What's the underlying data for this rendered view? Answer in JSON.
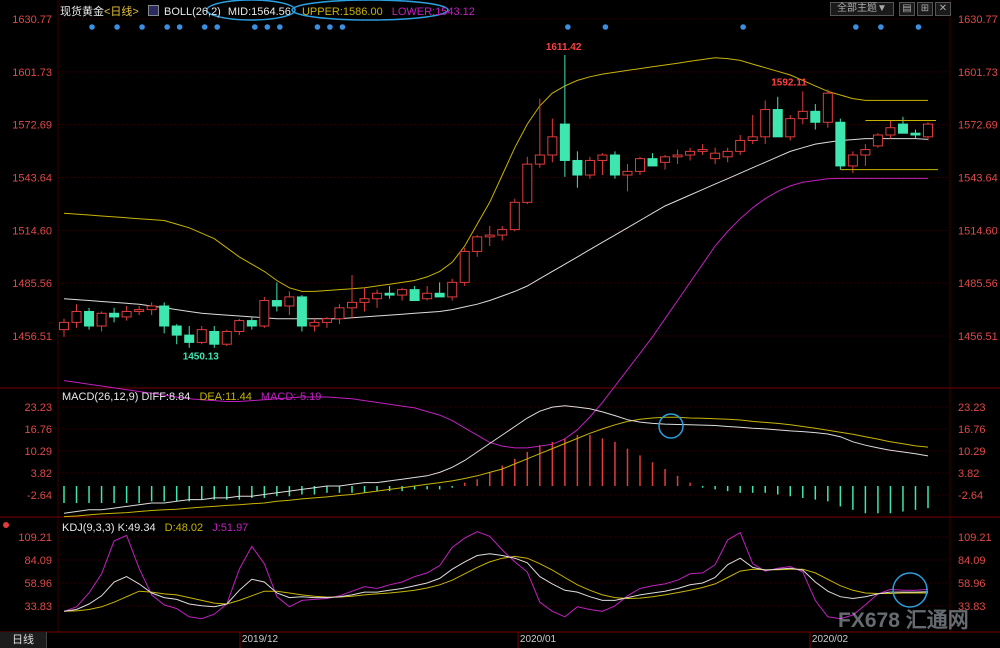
{
  "header": {
    "symbol": "现货黄金",
    "period": "<日线>",
    "indicator": "BOLL(26,2)",
    "mid": "MID:1564.56",
    "upper": "UPPER:1586.00",
    "lower": "LOWER:1543.12",
    "theme_button": "全部主题▼",
    "period_tab": "日线"
  },
  "macd_header": {
    "name": "MACD(26,12,9)",
    "diff": "DIFF:8.84",
    "dea": "DEA:11.44",
    "macd": "MACD:-5.19"
  },
  "kdj_header": {
    "name": "KDJ(9,3,3)",
    "k": "K:49.34",
    "d": "D:48.02",
    "j": "J:51.97"
  },
  "watermark": "FX678 汇通网",
  "colors": {
    "up": "#e03c3c",
    "down": "#3ee6b0",
    "mid": "#dddddd",
    "upper": "#c8b400",
    "lower": "#c020c0",
    "diff": "#dddddd",
    "dea": "#c8b400",
    "j": "#c020c0",
    "signal_dot": "#3a8fe0",
    "highlight": "#2aa0e0"
  },
  "chart_data": [
    {
      "type": "candlestick",
      "title": "现货黄金 日线 BOLL(26,2)",
      "y_ticks": [
        "1630.77",
        "1601.73",
        "1572.69",
        "1543.64",
        "1514.60",
        "1485.56",
        "1456.51"
      ],
      "ylim": [
        1441,
        1636
      ],
      "x_ticks": [
        "2019/12",
        "2020/01",
        "2020/02"
      ],
      "peak_labels": [
        {
          "text": "1611.42",
          "index": 38,
          "value": 1611.42
        },
        {
          "text": "1592.11",
          "index": 56,
          "value": 1592.11
        },
        {
          "text": "1450.13",
          "index": 9,
          "value": 1450.13
        }
      ],
      "ohlc": [
        [
          1460,
          1466,
          1456,
          1464
        ],
        [
          1464,
          1474,
          1461,
          1470
        ],
        [
          1470,
          1472,
          1460,
          1462
        ],
        [
          1462,
          1470,
          1459,
          1469
        ],
        [
          1469,
          1472,
          1464,
          1467
        ],
        [
          1467,
          1473,
          1465,
          1470
        ],
        [
          1470,
          1473,
          1468,
          1471
        ],
        [
          1471,
          1475,
          1468,
          1473
        ],
        [
          1473,
          1475,
          1458,
          1462
        ],
        [
          1462,
          1463,
          1452,
          1457
        ],
        [
          1457,
          1462,
          1450,
          1453
        ],
        [
          1453,
          1462,
          1452,
          1460
        ],
        [
          1459,
          1462,
          1450,
          1452
        ],
        [
          1452,
          1460,
          1451,
          1459
        ],
        [
          1459,
          1466,
          1457,
          1465
        ],
        [
          1465,
          1467,
          1460,
          1462
        ],
        [
          1462,
          1478,
          1461,
          1476
        ],
        [
          1476,
          1486,
          1470,
          1473
        ],
        [
          1473,
          1481,
          1468,
          1478
        ],
        [
          1478,
          1479,
          1459,
          1462
        ],
        [
          1462,
          1466,
          1459,
          1464
        ],
        [
          1464,
          1467,
          1461,
          1466
        ],
        [
          1466,
          1474,
          1463,
          1472
        ],
        [
          1472,
          1490,
          1466,
          1475
        ],
        [
          1475,
          1483,
          1470,
          1477
        ],
        [
          1477,
          1482,
          1472,
          1480
        ],
        [
          1480,
          1484,
          1477,
          1479
        ],
        [
          1479,
          1483,
          1476,
          1482
        ],
        [
          1482,
          1484,
          1478,
          1476
        ],
        [
          1477,
          1484,
          1476,
          1480
        ],
        [
          1480,
          1486,
          1478,
          1478
        ],
        [
          1478,
          1488,
          1476,
          1486
        ],
        [
          1486,
          1505,
          1484,
          1503
        ],
        [
          1503,
          1512,
          1500,
          1511
        ],
        [
          1511,
          1517,
          1506,
          1512
        ],
        [
          1512,
          1517,
          1509,
          1515
        ],
        [
          1515,
          1532,
          1514,
          1530
        ],
        [
          1530,
          1555,
          1529,
          1551
        ],
        [
          1551,
          1587,
          1549,
          1556
        ],
        [
          1556,
          1576,
          1552,
          1566
        ],
        [
          1573,
          1611,
          1544,
          1553
        ],
        [
          1553,
          1558,
          1538,
          1545
        ],
        [
          1545,
          1555,
          1543,
          1553
        ],
        [
          1553,
          1557,
          1545,
          1556
        ],
        [
          1556,
          1558,
          1543,
          1545
        ],
        [
          1545,
          1551,
          1536,
          1547
        ],
        [
          1547,
          1555,
          1545,
          1554
        ],
        [
          1554,
          1557,
          1550,
          1550
        ],
        [
          1552,
          1556,
          1548,
          1555
        ],
        [
          1555,
          1559,
          1551,
          1556
        ],
        [
          1556,
          1560,
          1553,
          1558
        ],
        [
          1558,
          1562,
          1556,
          1559
        ],
        [
          1554,
          1560,
          1551,
          1557
        ],
        [
          1555,
          1560,
          1552,
          1558
        ],
        [
          1558,
          1567,
          1556,
          1564
        ],
        [
          1564,
          1578,
          1562,
          1566
        ],
        [
          1566,
          1586,
          1562,
          1581
        ],
        [
          1581,
          1588,
          1572,
          1566
        ],
        [
          1566,
          1578,
          1564,
          1576
        ],
        [
          1576,
          1591,
          1573,
          1580
        ],
        [
          1580,
          1584,
          1570,
          1574
        ],
        [
          1574,
          1592,
          1571,
          1590
        ],
        [
          1574,
          1576,
          1548,
          1550
        ],
        [
          1550,
          1558,
          1546,
          1556
        ],
        [
          1556,
          1562,
          1550,
          1559
        ],
        [
          1561,
          1568,
          1560,
          1567
        ],
        [
          1567,
          1575,
          1565,
          1571
        ],
        [
          1573,
          1577,
          1569,
          1568
        ],
        [
          1568,
          1570,
          1565,
          1567
        ],
        [
          1566,
          1574,
          1564,
          1573
        ]
      ],
      "mid": [
        1477,
        1476.5,
        1476,
        1475.5,
        1475,
        1474.5,
        1474,
        1473,
        1472,
        1471,
        1470,
        1469,
        1468.5,
        1468,
        1467.5,
        1467,
        1466.5,
        1466,
        1466,
        1466,
        1466,
        1466,
        1466,
        1466.5,
        1467,
        1467.5,
        1468,
        1468.5,
        1469,
        1469.5,
        1470,
        1471,
        1472.5,
        1474,
        1476,
        1478.5,
        1481,
        1484,
        1488,
        1492,
        1496,
        1500,
        1504,
        1508,
        1512,
        1516,
        1520,
        1524,
        1528,
        1531,
        1534,
        1537,
        1540,
        1543,
        1546,
        1549,
        1552,
        1555,
        1558,
        1560,
        1562,
        1563,
        1564,
        1564.5,
        1565,
        1565,
        1565,
        1565,
        1565,
        1564.56
      ],
      "upper": [
        1524,
        1523.5,
        1523,
        1522.5,
        1522,
        1521.5,
        1521,
        1520.5,
        1520,
        1518,
        1516,
        1513,
        1510,
        1505,
        1500,
        1496,
        1492,
        1487,
        1483,
        1481,
        1481,
        1481.5,
        1482,
        1482.5,
        1483,
        1484,
        1485,
        1486,
        1487,
        1489,
        1492,
        1497,
        1506,
        1518,
        1530,
        1545,
        1560,
        1573,
        1583,
        1590,
        1594,
        1597,
        1599,
        1600.5,
        1601.5,
        1602.5,
        1603.5,
        1604.5,
        1605.5,
        1606.5,
        1607.5,
        1608.5,
        1609.5,
        1609,
        1608,
        1606,
        1604,
        1602,
        1600,
        1597,
        1594,
        1591,
        1589,
        1587,
        1586,
        1586,
        1586,
        1586,
        1586,
        1586
      ],
      "lower": [
        1432,
        1431,
        1430,
        1429,
        1428,
        1427,
        1426,
        1425,
        1424,
        1423,
        1422,
        1421.5,
        1421,
        1420.5,
        1420.5,
        1421,
        1421.5,
        1422,
        1422.5,
        1423,
        1423,
        1423,
        1422.5,
        1422,
        1421,
        1420,
        1419,
        1418,
        1417,
        1415,
        1413,
        1410,
        1406,
        1402,
        1398,
        1396,
        1395,
        1395,
        1396,
        1397,
        1400,
        1405,
        1412,
        1420,
        1429,
        1438,
        1447,
        1456,
        1466,
        1476,
        1486,
        1496,
        1506,
        1514,
        1521,
        1527,
        1532,
        1536,
        1539,
        1541,
        1542,
        1543,
        1543.12
      ]
    },
    {
      "type": "bar",
      "title": "MACD(26,12,9)",
      "y_ticks": [
        "23.23",
        "16.76",
        "10.29",
        "3.82",
        "-2.64"
      ],
      "ylim": [
        -10,
        26
      ],
      "histogram": [
        -5,
        -5,
        -5,
        -5,
        -5,
        -5,
        -5,
        -4.5,
        -4.5,
        -4.5,
        -4.5,
        -4,
        -4,
        -4,
        -4,
        -3.5,
        -3.5,
        -3,
        -3,
        -2.5,
        -2.5,
        -2,
        -2,
        -2,
        -2,
        -1.5,
        -1.5,
        -1.5,
        -1,
        -1,
        -1,
        -0.5,
        1,
        2,
        4,
        6,
        8,
        10,
        12,
        13,
        14,
        15,
        15,
        14,
        13,
        11,
        9,
        7,
        5,
        3,
        1,
        -0.5,
        -1,
        -1.5,
        -2,
        -2,
        -2,
        -2.5,
        -3,
        -3.5,
        -4,
        -4.5,
        -6,
        -7,
        -8,
        -8,
        -8,
        -7.5,
        -7,
        -6.5
      ],
      "diff": [
        -8,
        -7.5,
        -7,
        -7,
        -6.5,
        -6,
        -5.5,
        -5,
        -5,
        -4.5,
        -4,
        -4,
        -3.5,
        -3.5,
        -3,
        -3,
        -2.5,
        -2,
        -1.5,
        -1,
        -0.5,
        0,
        0,
        0.5,
        1,
        1,
        1.5,
        2,
        2.5,
        3,
        4,
        5.5,
        7.5,
        10,
        12.5,
        15,
        17.5,
        20,
        22,
        23.2,
        23.6,
        23.2,
        22.7,
        21.8,
        20.7,
        19.5,
        18.8,
        18.4,
        18.2,
        18.1,
        18,
        17.9,
        17.8,
        17.5,
        17.3,
        17,
        16.8,
        16.5,
        16.2,
        16,
        15.7,
        15.3,
        14.5,
        13,
        12,
        11.2,
        10.5,
        10,
        9.5,
        8.84
      ],
      "dea": [
        -9,
        -8.8,
        -8.5,
        -8.2,
        -8,
        -7.8,
        -7.5,
        -7.2,
        -7,
        -6.8,
        -6.5,
        -6.2,
        -6,
        -5.7,
        -5.5,
        -5.2,
        -5,
        -4.5,
        -4.2,
        -3.8,
        -3.5,
        -3.2,
        -2.8,
        -2.5,
        -2,
        -1.5,
        -1,
        -0.5,
        0,
        0.5,
        1,
        1.5,
        2.2,
        3,
        4,
        5,
        6.5,
        8,
        9.5,
        11,
        12.5,
        14,
        15.5,
        16.8,
        18,
        19,
        19.6,
        20,
        20.2,
        20.2,
        20,
        19.9,
        19.8,
        19.6,
        19.4,
        19,
        18.7,
        18.4,
        18,
        17.5,
        17,
        16.4,
        15.8,
        15.2,
        14.5,
        13.8,
        13,
        12.4,
        11.8,
        11.44
      ]
    },
    {
      "type": "line",
      "title": "KDJ(9,3,3)",
      "y_ticks": [
        "109.21",
        "84.09",
        "58.96",
        "33.83"
      ],
      "ylim": [
        20,
        113
      ],
      "x_ticks": [
        "2019/12",
        "2020/01",
        "2020/02"
      ],
      "k": [
        28,
        30,
        36,
        45,
        60,
        66,
        58,
        48,
        43,
        41,
        36,
        34,
        33,
        36,
        51,
        63,
        60,
        48,
        43,
        44,
        43,
        43,
        44,
        46,
        49,
        49,
        51,
        53,
        56,
        59,
        64,
        74,
        82,
        89,
        91,
        89,
        86,
        81,
        66,
        58,
        51,
        49,
        44,
        40,
        40,
        43,
        46,
        48,
        50,
        53,
        57,
        59,
        65,
        79,
        86,
        76,
        73,
        74,
        75,
        73,
        60,
        50,
        44,
        42,
        44,
        47,
        49,
        49,
        49,
        49.34
      ],
      "d": [
        28,
        28.5,
        30,
        33,
        38,
        44,
        50,
        49,
        47,
        46,
        43,
        40,
        37,
        36,
        40,
        45,
        50,
        50,
        48,
        46,
        44.5,
        43.5,
        43.5,
        44.5,
        46,
        47,
        48,
        49.5,
        51,
        53.5,
        57,
        62,
        69,
        76,
        82,
        86,
        88,
        86,
        80,
        73,
        65,
        57,
        51,
        46,
        43,
        42,
        42.5,
        44,
        46,
        48.5,
        51,
        54,
        58,
        65,
        72,
        74,
        73.5,
        73.5,
        74,
        74,
        70,
        63,
        56,
        51,
        48,
        47.5,
        47.5,
        48,
        48,
        48.02
      ],
      "j": [
        28,
        33,
        48,
        69,
        105,
        111,
        75,
        46,
        35,
        31,
        22,
        20,
        25,
        36,
        74,
        99,
        80,
        44,
        33,
        40,
        41,
        42,
        45,
        50,
        55,
        53,
        57,
        60,
        66,
        70,
        78,
        98,
        108,
        115,
        110,
        95,
        82,
        71,
        38,
        28,
        22,
        33,
        30,
        28,
        34,
        45,
        53,
        56,
        58,
        62,
        69,
        70,
        79,
        106,
        114,
        80,
        72,
        75,
        77,
        71,
        40,
        22,
        20,
        24,
        35,
        47,
        52,
        51,
        51,
        51.97
      ]
    }
  ]
}
